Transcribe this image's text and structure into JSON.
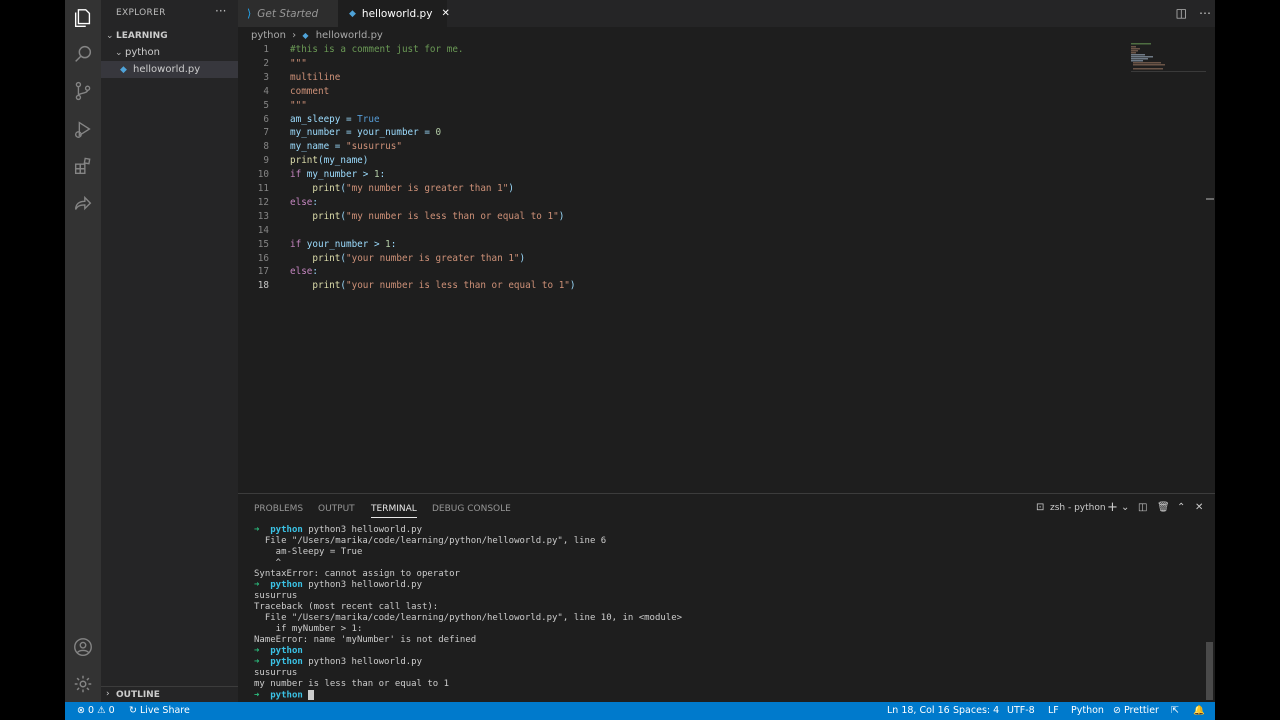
{
  "sidebar": {
    "title": "EXPLORER",
    "more": "···",
    "root": "LEARNING",
    "folder": "python",
    "file": "helloworld.py",
    "outline": "OUTLINE"
  },
  "tabs": {
    "get_started": "Get Started",
    "active": "helloworld.py",
    "close": "✕"
  },
  "breadcrumb": {
    "folder": "python",
    "sep": "›",
    "file": "helloworld.py"
  },
  "editor": {
    "current_line": 18,
    "lines": [
      {
        "n": "1",
        "text": "#this is a comment just for me."
      },
      {
        "n": "2",
        "text": "\"\"\""
      },
      {
        "n": "3",
        "text": "multiline"
      },
      {
        "n": "4",
        "text": "comment"
      },
      {
        "n": "5",
        "text": "\"\"\""
      },
      {
        "n": "6",
        "text": "am_sleepy = True"
      },
      {
        "n": "7",
        "text": "my_number = your_number = 0"
      },
      {
        "n": "8",
        "text": "my_name = \"susurrus\""
      },
      {
        "n": "9",
        "text": "print(my_name)"
      },
      {
        "n": "10",
        "text": "if my_number > 1:"
      },
      {
        "n": "11",
        "text": "    print(\"my number is greater than 1\")"
      },
      {
        "n": "12",
        "text": "else:"
      },
      {
        "n": "13",
        "text": "    print(\"my number is less than or equal to 1\")"
      },
      {
        "n": "14",
        "text": ""
      },
      {
        "n": "15",
        "text": "if your_number > 1:"
      },
      {
        "n": "16",
        "text": "    print(\"your number is greater than 1\")"
      },
      {
        "n": "17",
        "text": "else:"
      },
      {
        "n": "18",
        "text": "    print(\"your number is less than or equal to 1\")"
      }
    ]
  },
  "panel": {
    "tabs": [
      "PROBLEMS",
      "OUTPUT",
      "TERMINAL",
      "DEBUG CONSOLE"
    ],
    "active_tab": "TERMINAL",
    "shell": "zsh - python",
    "terminal": [
      {
        "arrow": "➜",
        "dir": "python",
        "text": "python3 helloworld.py"
      },
      {
        "text": "  File \"/Users/marika/code/learning/python/helloworld.py\", line 6"
      },
      {
        "text": "    am-Sleepy = True"
      },
      {
        "text": "    ^"
      },
      {
        "text": "SyntaxError: cannot assign to operator"
      },
      {
        "arrow": "➜",
        "dir": "python",
        "text": "python3 helloworld.py"
      },
      {
        "text": "susurrus"
      },
      {
        "text": "Traceback (most recent call last):"
      },
      {
        "text": "  File \"/Users/marika/code/learning/python/helloworld.py\", line 10, in <module>"
      },
      {
        "text": "    if myNumber > 1:"
      },
      {
        "text": "NameError: name 'myNumber' is not defined"
      },
      {
        "arrow": "➜",
        "dir": "python",
        "text": ""
      },
      {
        "arrow": "➜",
        "dir": "python",
        "text": "python3 helloworld.py"
      },
      {
        "text": "susurrus"
      },
      {
        "text": "my number is less than or equal to 1"
      },
      {
        "arrow": "➜",
        "dir": "python",
        "text": "",
        "cursor": true
      }
    ]
  },
  "status": {
    "errors": "0",
    "warnings": "0",
    "live_share": "Live Share",
    "position": "Ln 18, Col 16",
    "spaces": "Spaces: 4",
    "encoding": "UTF-8",
    "eol": "LF",
    "language": "Python",
    "prettier": "Prettier"
  },
  "colors": {
    "status_bar": "#007acc",
    "activity_bar": "#333333",
    "editor_bg": "#1e1e1e"
  }
}
